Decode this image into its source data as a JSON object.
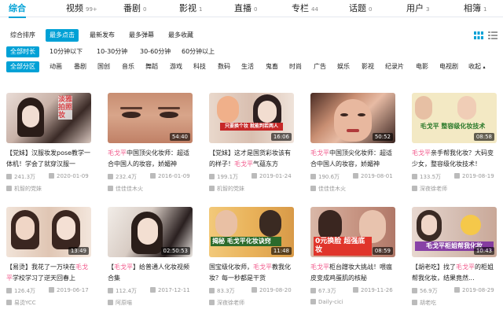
{
  "tabs": [
    {
      "label": "综合",
      "count": "",
      "active": true
    },
    {
      "label": "视频",
      "count": "99+"
    },
    {
      "label": "番剧",
      "count": "0"
    },
    {
      "label": "影视",
      "count": "1"
    },
    {
      "label": "直播",
      "count": "0"
    },
    {
      "label": "专栏",
      "count": "44"
    },
    {
      "label": "话题",
      "count": "0"
    },
    {
      "label": "用户",
      "count": "3"
    },
    {
      "label": "相簿",
      "count": "1"
    }
  ],
  "sort_options": [
    "综合排序",
    "最多点击",
    "最新发布",
    "最多弹幕",
    "最多收藏"
  ],
  "sort_active": "最多点击",
  "duration_options": [
    "全部时长",
    "10分钟以下",
    "10-30分钟",
    "30-60分钟",
    "60分钟以上"
  ],
  "zones": [
    "全部分区",
    "动画",
    "番剧",
    "国创",
    "音乐",
    "舞蹈",
    "游戏",
    "科技",
    "数码",
    "生活",
    "鬼畜",
    "时尚",
    "广告",
    "娱乐",
    "影视",
    "纪录片",
    "电影",
    "电视剧",
    "收起"
  ],
  "colors": {
    "accent": "#00a1d6",
    "keyword": "#f25d8e"
  },
  "videos": [
    {
      "duration": "",
      "title_pre": "【党妹】汉服妆发pose教学一体机！学会了就穿汉服一",
      "title_kw": "",
      "title_post": "",
      "views": "241.3万",
      "date": "2020-01-09",
      "uploader": "机智的党妹",
      "overlay": "淡雅拍照妆",
      "overlay_color": "#d8464a"
    },
    {
      "duration": "54:40",
      "title_pre": "",
      "title_kw": "毛戈平",
      "title_post": "中国顶尖化妆师：超适合中国人的妆容，娇媚神",
      "views": "232.4万",
      "date": "2016-01-09",
      "uploader": "佳佳佳木火",
      "overlay": "",
      "overlay_color": ""
    },
    {
      "duration": "16:06",
      "title_pre": "【党妹】这才是国货彩妆该有的样子！",
      "title_kw": "毛戈平",
      "title_post": "气蕴东方",
      "views": "199.1万",
      "date": "2019-01-24",
      "uploader": "机智的党妹",
      "overlay": "只要换个妆 就能判若两人",
      "overlay_color": "#ffffff"
    },
    {
      "duration": "50:52",
      "title_pre": "",
      "title_kw": "毛戈平",
      "title_post": "中国顶尖化妆师：超适合中国人的妆容，娇媚神",
      "views": "190.6万",
      "date": "2019-08-01",
      "uploader": "佳佳佳木火",
      "overlay": "",
      "overlay_color": ""
    },
    {
      "duration": "08:58",
      "title_pre": "",
      "title_kw": "毛戈平",
      "title_post": "亲手帮我化妆？大码变少女，整容级化妆技术！",
      "views": "133.5万",
      "date": "2019-08-19",
      "uploader": "深夜徐老师",
      "overlay": "毛戈平 整容级化妆技术",
      "overlay_color": "#2b7a2b"
    },
    {
      "duration": "13:49",
      "title_pre": "【易烫】我花了一万块在",
      "title_kw": "毛戈平",
      "title_post": "学校学习了逆天回春上",
      "views": "126.4万",
      "date": "2019-06-17",
      "uploader": "易烫YCC",
      "overlay": "",
      "overlay_color": ""
    },
    {
      "duration": "02:50:53",
      "title_pre": "【",
      "title_kw": "毛戈平",
      "title_post": "】给普通人化妆视频合集",
      "views": "112.4万",
      "date": "2017-12-11",
      "uploader": "阿原喵",
      "overlay": "",
      "overlay_color": ""
    },
    {
      "duration": "11:48",
      "title_pre": "国宝级化妆师，",
      "title_kw": "毛戈平",
      "title_post": "教我化妆？每一秒都是干货",
      "views": "83.3万",
      "date": "2019-08-20",
      "uploader": "深夜徐老师",
      "overlay": "揭秘 毛戈平化妆诀窍",
      "overlay_color": "#ffffff"
    },
    {
      "duration": "08:59",
      "title_pre": "",
      "title_kw": "毛戈平",
      "title_post": "柜台蹭妆大挑战！喂瘟皮变成鸡蛋肌的核秘",
      "views": "67.3万",
      "date": "2019-11-26",
      "uploader": "Daily-cici",
      "overlay": "0元换脸 超强底妆",
      "overlay_color": "#ffffff"
    },
    {
      "duration": "10:43",
      "title_pre": "【胡老吃】找了",
      "title_kw": "毛戈平",
      "title_post": "的柜姐帮我化妆，结果竟然...",
      "views": "56.9万",
      "date": "2019-08-29",
      "uploader": "胡老吃",
      "overlay": "毛戈平柜姐帮我化妆",
      "overlay_color": "#ffffff"
    }
  ]
}
